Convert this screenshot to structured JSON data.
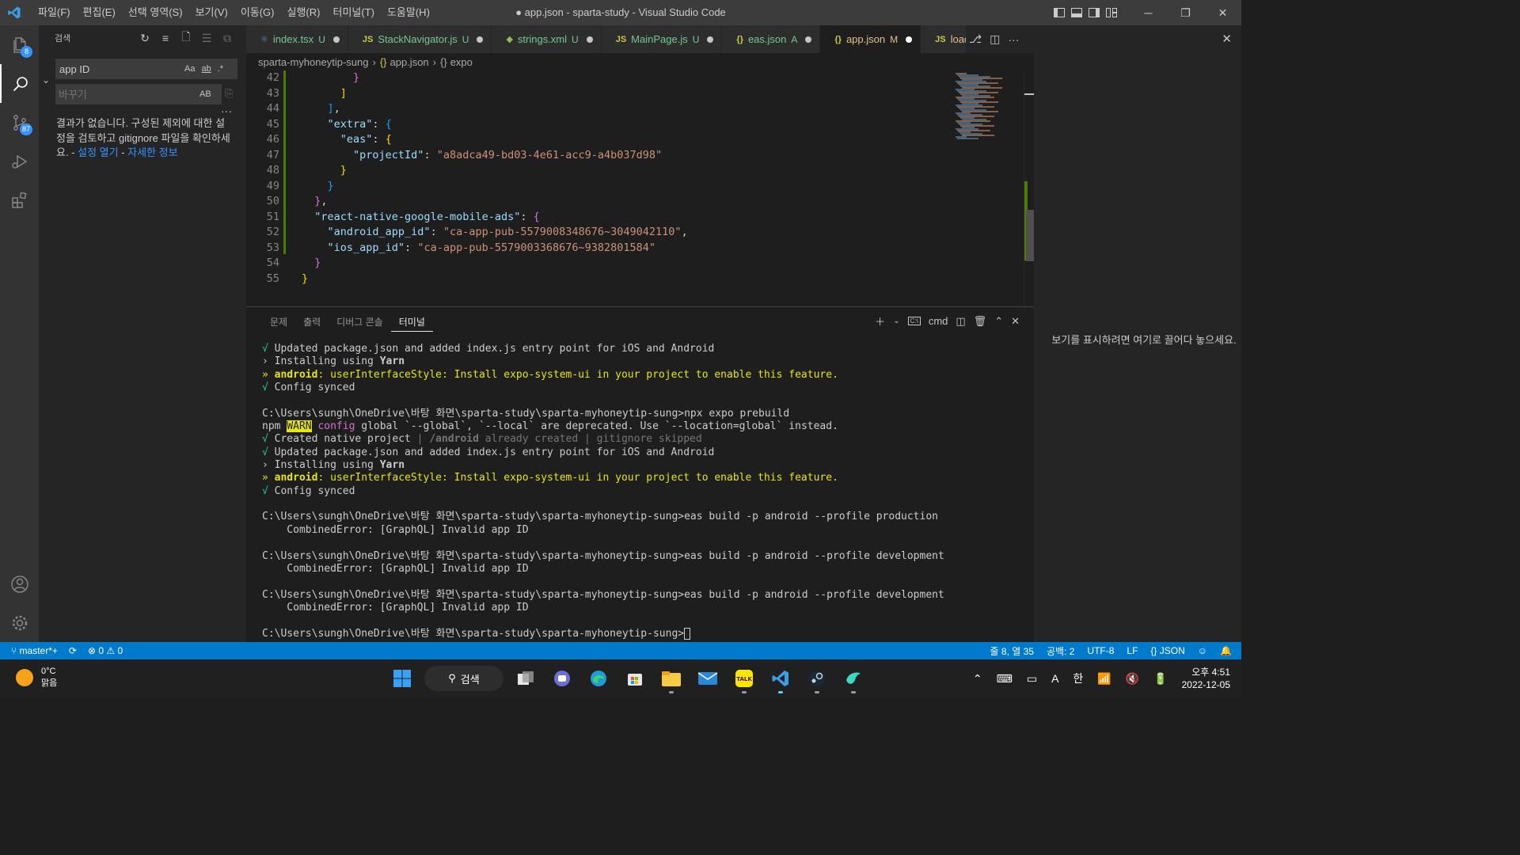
{
  "window": {
    "title": "● app.json - sparta-study - Visual Studio Code",
    "menu": [
      "파일(F)",
      "편집(E)",
      "선택 영역(S)",
      "보기(V)",
      "이동(G)",
      "실행(R)",
      "터미널(T)",
      "도움말(H)"
    ]
  },
  "activity": {
    "explorer_badge": "8",
    "scm_badge": "87"
  },
  "sidebar": {
    "title": "검색",
    "search_value": "app ID",
    "replace_placeholder": "바꾸기",
    "opt_case": "Aa",
    "opt_word": "ab",
    "opt_regex": ".*",
    "opt_preserve": "AB",
    "no_results_text": "결과가 없습니다. 구성된 제외에 대한 설정을 검토하고 gitignore 파일을 확인하세요. - ",
    "open_settings": "설정 열기",
    "dash": " - ",
    "learn_more": "자세한 정보"
  },
  "tabs": [
    {
      "label": "index.tsx",
      "status": "U",
      "icon": "react-icon",
      "icon_text": "⚛",
      "icon_color": "#519aba",
      "active": false
    },
    {
      "label": "StackNavigator.js",
      "status": "U",
      "icon": "js-icon",
      "icon_text": "JS",
      "icon_color": "#cbcb41",
      "active": false
    },
    {
      "label": "strings.xml",
      "status": "U",
      "icon": "xml-icon",
      "icon_text": "◆",
      "icon_color": "#8dc149",
      "active": false
    },
    {
      "label": "MainPage.js",
      "status": "U",
      "icon": "js-icon",
      "icon_text": "JS",
      "icon_color": "#cbcb41",
      "active": false
    },
    {
      "label": "eas.json",
      "status": "A",
      "icon": "json-icon",
      "icon_text": "{}",
      "icon_color": "#cbcb41",
      "active": false
    },
    {
      "label": "app.json",
      "status": "M",
      "icon": "json-icon",
      "icon_text": "{}",
      "icon_color": "#cbcb41",
      "active": true
    },
    {
      "label": "loadi",
      "status": "",
      "icon": "js-icon",
      "icon_text": "JS",
      "icon_color": "#cbcb41",
      "active": false
    }
  ],
  "breadcrumb": {
    "folder": "sparta-myhoneytip-sung",
    "file": "app.json",
    "symbol": "expo"
  },
  "code_lines": [
    {
      "n": "42",
      "html": "        <span class=\"p2\">}</span>"
    },
    {
      "n": "43",
      "html": "      <span class=\"p1\">]</span>"
    },
    {
      "n": "44",
      "html": "    <span class=\"p3\">]</span>,"
    },
    {
      "n": "45",
      "html": "    <span class=\"k\">\"extra\"</span>: <span class=\"p3\">{</span>"
    },
    {
      "n": "46",
      "html": "      <span class=\"k\">\"eas\"</span>: <span class=\"p1\">{</span>"
    },
    {
      "n": "47",
      "html": "        <span class=\"k\">\"projectId\"</span>: <span class=\"s\">\"a8adca49-bd03-4e61-acc9-a4b037d98\"</span>"
    },
    {
      "n": "48",
      "html": "      <span class=\"p1\">}</span>"
    },
    {
      "n": "49",
      "html": "    <span class=\"p3\">}</span>"
    },
    {
      "n": "50",
      "html": "  <span class=\"p2\">}</span>,"
    },
    {
      "n": "51",
      "html": "  <span class=\"k\">\"react-native-google-mobile-ads\"</span>: <span class=\"p2\">{</span>"
    },
    {
      "n": "52",
      "html": "    <span class=\"k\">\"android_app_id\"</span>: <span class=\"s\">\"ca-app-pub-5579008348676~3049042110\"</span>,"
    },
    {
      "n": "53",
      "html": "    <span class=\"k\">\"ios_app_id\"</span>: <span class=\"s\">\"ca-app-pub-5579003368676~9382801584\"</span>"
    },
    {
      "n": "54",
      "html": "  <span class=\"p2\">}</span>"
    },
    {
      "n": "55",
      "html": "<span class=\"p1\">}</span>"
    }
  ],
  "panel": {
    "tabs": [
      "문제",
      "출력",
      "디버그 콘솔",
      "터미널"
    ],
    "active_tab": "터미널",
    "shell": "cmd"
  },
  "terminal_lines": [
    "<span class=\"green\">√</span> Updated package.json and added index.js entry point for iOS and Android",
    "› Installing using <span class=\"bold\">Yarn</span>",
    "<span class=\"yellow\">» <span class=\"bold\">android</span>: userInterfaceStyle: Install expo-system-ui in your project to enable this feature.</span>",
    "<span class=\"green\">√</span> Config synced",
    "",
    "C:\\Users\\sungh\\OneDrive\\바탕 화면\\sparta-study\\sparta-myhoneytip-sung>npx expo prebuild",
    "npm <span class=\"warn-bg\">WARN</span> <span class=\"magenta\">config</span> global `--global`, `--local` are deprecated. Use `--location=global` instead.",
    "<span class=\"green\">√</span> Created native project <span class=\"dim\">| <span class=\"bold\">/android</span> already created | gitignore skipped</span>",
    "<span class=\"green\">√</span> Updated package.json and added index.js entry point for iOS and Android",
    "› Installing using <span class=\"bold\">Yarn</span>",
    "<span class=\"yellow\">» <span class=\"bold\">android</span>: userInterfaceStyle: Install expo-system-ui in your project to enable this feature.</span>",
    "<span class=\"green\">√</span> Config synced",
    "",
    "C:\\Users\\sungh\\OneDrive\\바탕 화면\\sparta-study\\sparta-myhoneytip-sung>eas build -p android --profile production",
    "    CombinedError: [GraphQL] Invalid app ID",
    "",
    "C:\\Users\\sungh\\OneDrive\\바탕 화면\\sparta-study\\sparta-myhoneytip-sung>eas build -p android --profile development",
    "    CombinedError: [GraphQL] Invalid app ID",
    "",
    "C:\\Users\\sungh\\OneDrive\\바탕 화면\\sparta-study\\sparta-myhoneytip-sung>eas build -p android --profile development",
    "    CombinedError: [GraphQL] Invalid app ID",
    "",
    "C:\\Users\\sungh\\OneDrive\\바탕 화면\\sparta-study\\sparta-myhoneytip-sung>"
  ],
  "right_pane": {
    "hint": "보기를 표시하려면 여기로 끌어다 놓으세요."
  },
  "statusbar": {
    "branch": "master*+",
    "errors": "0",
    "warnings": "0",
    "position": "줄 8, 열 35",
    "spaces": "공백: 2",
    "encoding": "UTF-8",
    "eol": "LF",
    "language": "{} JSON"
  },
  "taskbar": {
    "temp": "0°C",
    "weather": "맑음",
    "search": "검색",
    "time": "오후 4:51",
    "date": "2022-12-05",
    "ime": "한",
    "font_icon": "A"
  }
}
